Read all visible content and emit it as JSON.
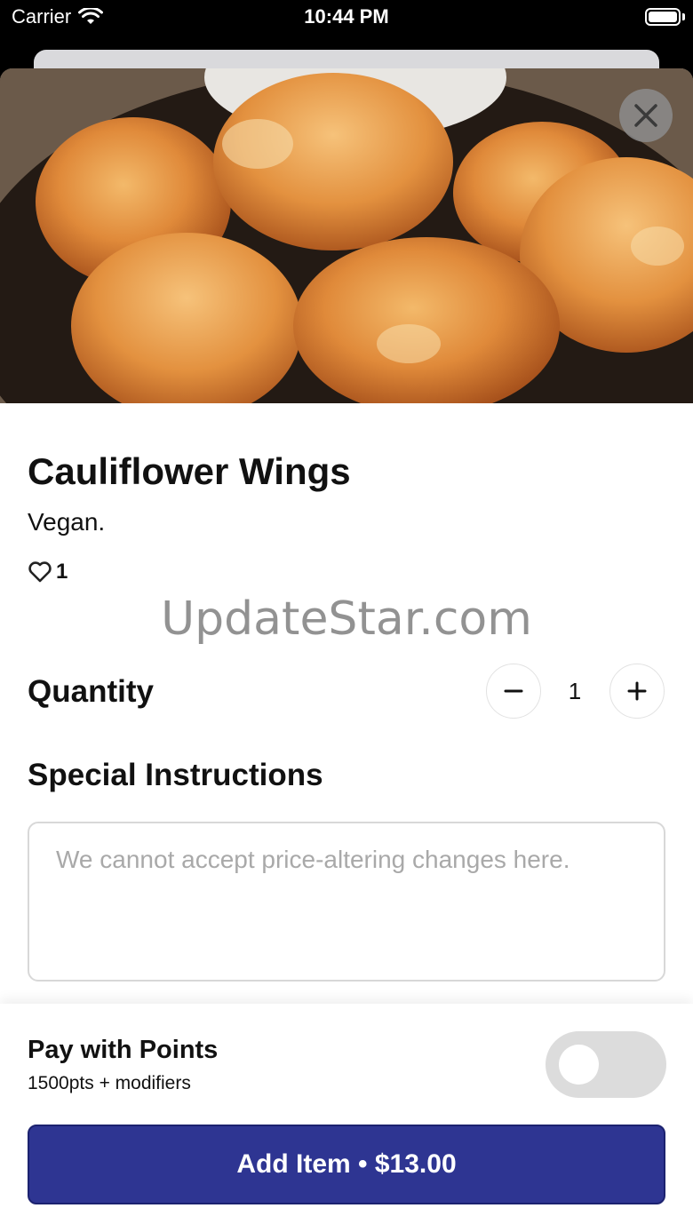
{
  "status_bar": {
    "carrier": "Carrier",
    "time": "10:44 PM"
  },
  "item": {
    "title": "Cauliflower Wings",
    "description": "Vegan.",
    "likes": "1",
    "image_icon": "fried-cauliflower-photo"
  },
  "watermark": "UpdateStar.com",
  "quantity": {
    "label": "Quantity",
    "value": "1",
    "minus_icon": "minus-icon",
    "plus_icon": "plus-icon"
  },
  "instructions": {
    "label": "Special Instructions",
    "placeholder": "We cannot accept price-altering changes here.",
    "value": ""
  },
  "points": {
    "title": "Pay with Points",
    "subtitle": "1500pts + modifiers",
    "enabled": false
  },
  "add_button": {
    "label": "Add Item • $13.00"
  },
  "colors": {
    "primary": "#2e3592",
    "toggle_off": "#dcdcdc",
    "close_bg": "#8c8c8c"
  }
}
